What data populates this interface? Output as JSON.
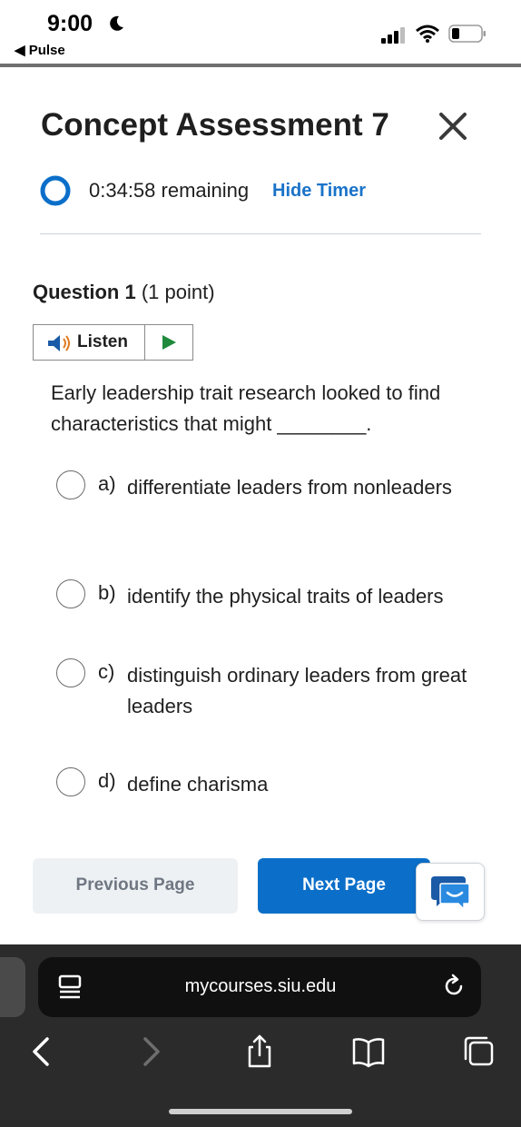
{
  "status_bar": {
    "time": "9:00",
    "back_label": "◀ Pulse"
  },
  "header": {
    "title": "Concept Assessment 7",
    "timer_text": "0:34:58 remaining",
    "hide_timer_label": "Hide Timer"
  },
  "question": {
    "number_label": "Question 1",
    "points_label": "(1 point)",
    "listen_label": "Listen",
    "text": "Early leadership trait research looked to find characteristics that might ________.",
    "choices": [
      {
        "letter": "a)",
        "text": "differentiate leaders from nonleaders"
      },
      {
        "letter": "b)",
        "text": "identify the physical traits of leaders"
      },
      {
        "letter": "c)",
        "text": "distinguish ordinary leaders from great leaders"
      },
      {
        "letter": "d)",
        "text": "define charisma"
      }
    ]
  },
  "nav": {
    "previous_label": "Previous Page",
    "next_label": "Next Page"
  },
  "browser": {
    "url": "mycourses.siu.edu"
  },
  "colors": {
    "accent": "#0b6fc9",
    "link": "#1a73c9",
    "chrome_bg": "#2b2b2b"
  }
}
